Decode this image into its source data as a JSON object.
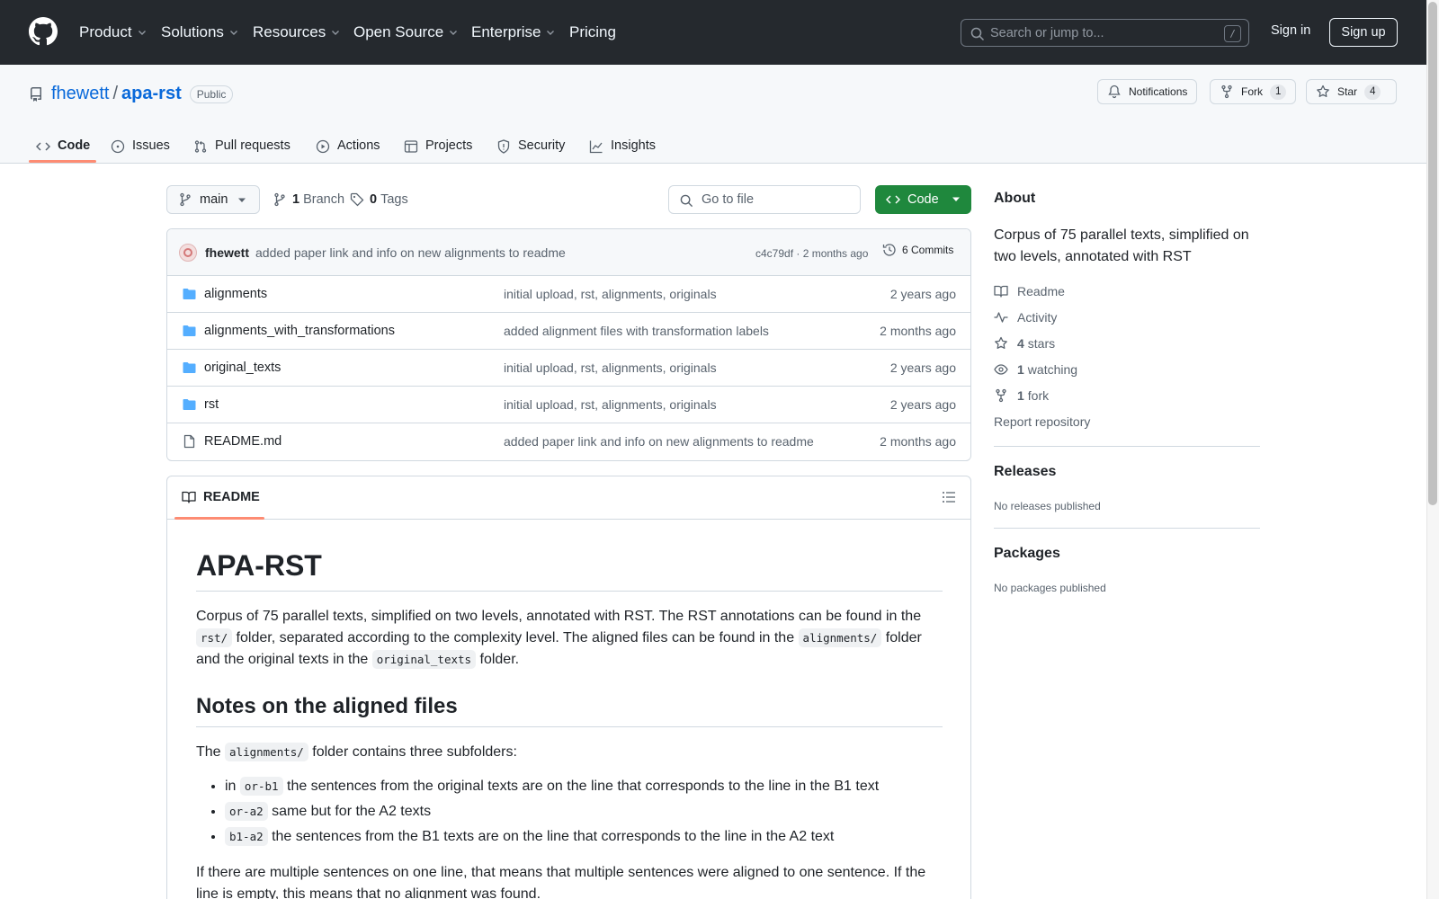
{
  "header": {
    "nav": [
      "Product",
      "Solutions",
      "Resources",
      "Open Source",
      "Enterprise",
      "Pricing"
    ],
    "search_placeholder": "Search or jump to...",
    "search_shortcut": "/",
    "sign_in": "Sign in",
    "sign_up": "Sign up"
  },
  "repo": {
    "owner": "fhewett",
    "separator": "/",
    "name": "apa-rst",
    "visibility": "Public",
    "notifications_label": "Notifications",
    "fork_label": "Fork",
    "fork_count": "1",
    "star_label": "Star",
    "star_count": "4",
    "tabs": [
      "Code",
      "Issues",
      "Pull requests",
      "Actions",
      "Projects",
      "Security",
      "Insights"
    ],
    "active_tab": "Code"
  },
  "toolbar": {
    "branch": "main",
    "branch_count": "1",
    "branch_label": "Branch",
    "tag_count": "0",
    "tag_label": "Tags",
    "goto_placeholder": "Go to file",
    "code_button": "Code"
  },
  "latest_commit": {
    "author": "fhewett",
    "message": "added paper link and info on new alignments to readme",
    "hash_time": "c4c79df · 2 months ago",
    "commits": "6 Commits"
  },
  "files": [
    {
      "name": "alignments",
      "type": "folder",
      "message": "initial upload, rst, alignments, originals",
      "date": "2 years ago"
    },
    {
      "name": "alignments_with_transformations",
      "type": "folder",
      "message": "added alignment files with transformation labels",
      "date": "2 months ago"
    },
    {
      "name": "original_texts",
      "type": "folder",
      "message": "initial upload, rst, alignments, originals",
      "date": "2 years ago"
    },
    {
      "name": "rst",
      "type": "folder",
      "message": "initial upload, rst, alignments, originals",
      "date": "2 years ago"
    },
    {
      "name": "README.md",
      "type": "file",
      "message": "added paper link and info on new alignments to readme",
      "date": "2 months ago"
    }
  ],
  "readme": {
    "tab_label": "README",
    "h1": "APA-RST",
    "p1_a": "Corpus of 75 parallel texts, simplified on two levels, annotated with RST. The RST annotations can be found in the ",
    "p1_code1": "rst/",
    "p1_b": " folder, separated according to the complexity level. The aligned files can be found in the ",
    "p1_code2": "alignments/",
    "p1_c": " folder and the original texts in the ",
    "p1_code3": "original_texts",
    "p1_d": " folder.",
    "h2": "Notes on the aligned files",
    "p2_a": "The ",
    "p2_code": "alignments/",
    "p2_b": " folder contains three subfolders:",
    "li1_a": "in ",
    "li1_code": "or-b1",
    "li1_b": " the sentences from the original texts are on the line that corresponds to the line in the B1 text",
    "li2_code": "or-a2",
    "li2_b": " same but for the A2 texts",
    "li3_code": "b1-a2",
    "li3_b": " the sentences from the B1 texts are on the line that corresponds to the line in the A2 text",
    "p3": "If there are multiple sentences on one line, that means that multiple sentences were aligned to one sentence. If the line is empty, this means that no alignment was found."
  },
  "sidebar": {
    "about_title": "About",
    "description": "Corpus of 75 parallel texts, simplified on two levels, annotated with RST",
    "readme": "Readme",
    "activity": "Activity",
    "stars_count": "4",
    "stars_label": "stars",
    "watching_count": "1",
    "watching_label": "watching",
    "forks_count": "1",
    "forks_label": "fork",
    "report": "Report repository",
    "releases_title": "Releases",
    "releases_text": "No releases published",
    "packages_title": "Packages",
    "packages_text": "No packages published"
  },
  "colors": {
    "header_bg": "#25292e",
    "link": "#0969da",
    "code_button": "#1f883d",
    "tab_underline": "#fd8c73",
    "folder_icon": "#54aeff"
  }
}
